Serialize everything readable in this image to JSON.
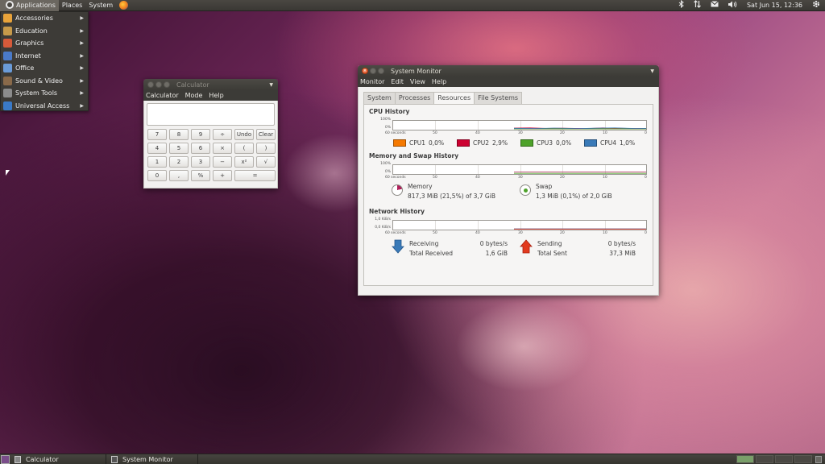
{
  "top_panel": {
    "menus": [
      "Applications",
      "Places",
      "System"
    ],
    "clock": "Sat Jun 15, 12:36"
  },
  "app_menu": {
    "items": [
      {
        "label": "Accessories",
        "icon": "accessories-icon",
        "color": "#e8a33a"
      },
      {
        "label": "Education",
        "icon": "education-icon",
        "color": "#c79a4a"
      },
      {
        "label": "Graphics",
        "icon": "graphics-icon",
        "color": "#d65a3a"
      },
      {
        "label": "Internet",
        "icon": "internet-icon",
        "color": "#4a7ac8"
      },
      {
        "label": "Office",
        "icon": "office-icon",
        "color": "#6a9bd8"
      },
      {
        "label": "Sound & Video",
        "icon": "sound-video-icon",
        "color": "#8a6a4a"
      },
      {
        "label": "System Tools",
        "icon": "system-tools-icon",
        "color": "#8c8c8c"
      },
      {
        "label": "Universal Access",
        "icon": "universal-access-icon",
        "color": "#3a7ac8"
      }
    ]
  },
  "calculator": {
    "title": "Calculator",
    "menu": [
      "Calculator",
      "Mode",
      "Help"
    ],
    "display": "",
    "buttons": [
      "7",
      "8",
      "9",
      "÷",
      "Undo",
      "Clear",
      "4",
      "5",
      "6",
      "×",
      "(",
      ")",
      "1",
      "2",
      "3",
      "−",
      "x²",
      "√",
      "0",
      ",",
      "%",
      "+",
      "="
    ]
  },
  "system_monitor": {
    "title": "System Monitor",
    "menu": [
      "Monitor",
      "Edit",
      "View",
      "Help"
    ],
    "tabs": [
      "System",
      "Processes",
      "Resources",
      "File Systems"
    ],
    "active_tab": "Resources",
    "cpu": {
      "title": "CPU History",
      "y_top": "100%",
      "y_bottom": "0%",
      "x_ticks": [
        "60 seconds",
        "50",
        "40",
        "30",
        "20",
        "10",
        "0"
      ],
      "cores": [
        {
          "label": "CPU1",
          "value": "0,0%",
          "color": "#f57900"
        },
        {
          "label": "CPU2",
          "value": "2,9%",
          "color": "#cc0030"
        },
        {
          "label": "CPU3",
          "value": "0,0%",
          "color": "#4ea22a"
        },
        {
          "label": "CPU4",
          "value": "1,0%",
          "color": "#3a7ab8"
        }
      ]
    },
    "memory": {
      "title": "Memory and Swap History",
      "y_top": "100%",
      "y_bottom": "0%",
      "x_ticks": [
        "60 seconds",
        "50",
        "40",
        "30",
        "20",
        "10",
        "0"
      ],
      "memory_label": "Memory",
      "memory_value": "817,3 MiB (21,5%) of 3,7 GiB",
      "memory_fraction": 0.215,
      "memory_color": "#b0205a",
      "swap_label": "Swap",
      "swap_value": "1,3 MiB (0,1%) of 2,0 GiB",
      "swap_color": "#4ea22a"
    },
    "network": {
      "title": "Network History",
      "y_top": "1,0 KiB/s",
      "y_bottom": "0,0 KiB/s",
      "x_ticks": [
        "60 seconds",
        "50",
        "40",
        "30",
        "20",
        "10",
        "0"
      ],
      "receiving_label": "Receiving",
      "receiving_value": "0 bytes/s",
      "total_received_label": "Total Received",
      "total_received_value": "1,6 GiB",
      "sending_label": "Sending",
      "sending_value": "0 bytes/s",
      "total_sent_label": "Total Sent",
      "total_sent_value": "37,3 MiB",
      "receiving_color": "#3a7ab8",
      "sending_color": "#d4261a"
    }
  },
  "bottom_panel": {
    "tasks": [
      "Calculator",
      "System Monitor"
    ]
  }
}
